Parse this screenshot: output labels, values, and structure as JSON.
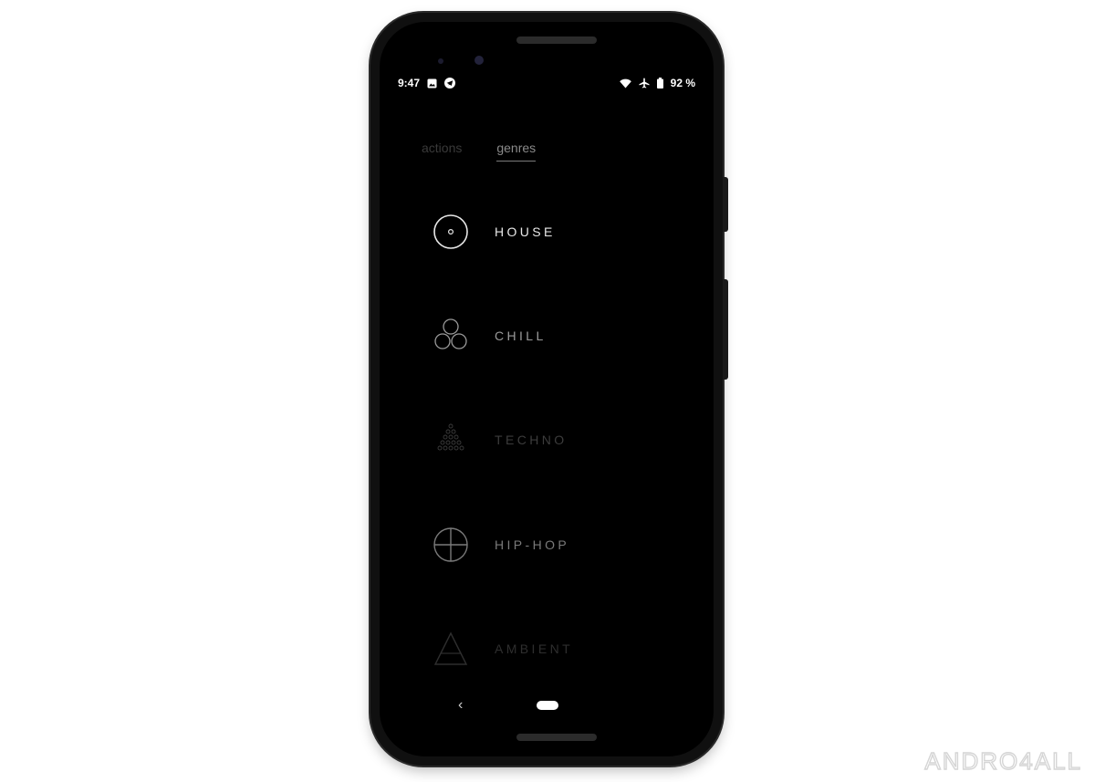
{
  "status_bar": {
    "time": "9:47",
    "battery": "92 %",
    "left_icons": [
      "image-icon",
      "telegram-icon"
    ],
    "right_icons": [
      "wifi-icon",
      "airplane-icon",
      "battery-icon"
    ]
  },
  "tabs": [
    {
      "label": "actions",
      "active": false
    },
    {
      "label": "genres",
      "active": true
    }
  ],
  "genres": [
    {
      "label": "HOUSE",
      "icon": "circle-dot-icon",
      "color": "#e8e8e8"
    },
    {
      "label": "CHILL",
      "icon": "three-circles-icon",
      "color": "#9a9a9a"
    },
    {
      "label": "TECHNO",
      "icon": "dot-triangle-icon",
      "color": "#3c3c3c"
    },
    {
      "label": "HIP-HOP",
      "icon": "crosshair-circle-icon",
      "color": "#7a7a7a"
    },
    {
      "label": "AMBIENT",
      "icon": "triangle-icon",
      "color": "#2e2e2e"
    }
  ],
  "navbar": {
    "back_glyph": "‹"
  },
  "watermark": {
    "brand": "andro4all",
    "display": "ANDRO4ALL",
    "color": "#d5d5d5"
  }
}
